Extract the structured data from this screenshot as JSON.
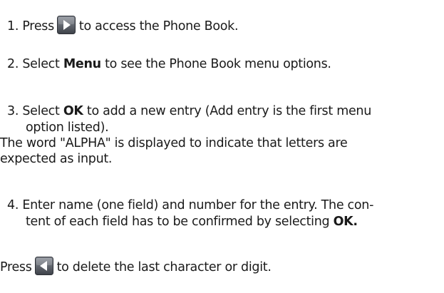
{
  "step1": {
    "pre": "1. Press",
    "post": "to access the Phone Book.",
    "icon": "right-arrow-key-icon"
  },
  "step2": {
    "pre": "2. Select ",
    "bold": "Menu",
    "post": " to see the Phone Book menu options."
  },
  "step3": {
    "line1_pre": "3. Select ",
    "line1_bold": "OK",
    "line1_post": " to add a new entry (Add entry is the first menu",
    "line2": "option listed)."
  },
  "note": {
    "line1": "The word \"ALPHA\" is displayed to indicate that letters are",
    "line2": "expected as input."
  },
  "step4": {
    "line1": "4. Enter name (one field) and number for the entry. The con-",
    "line2_pre": "tent of each field has to be confirmed by selecting ",
    "line2_bold": "OK."
  },
  "footer": {
    "pre": "Press",
    "post": "to delete the last character or digit.",
    "icon": "left-arrow-key-icon"
  }
}
